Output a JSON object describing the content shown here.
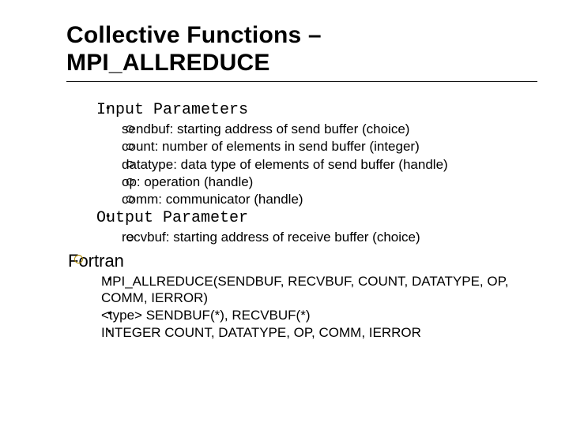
{
  "title_line1": "Collective Functions –",
  "title_line2": "MPI_ALLREDUCE",
  "sections": {
    "input": {
      "label": "Input Parameters",
      "items": [
        "sendbuf: starting address of send buffer (choice)",
        "count: number of elements in send buffer (integer)",
        "datatype: data type of elements of send buffer (handle)",
        "op: operation (handle)",
        "comm: communicator (handle)"
      ]
    },
    "output": {
      "label": "Output Parameter",
      "items": [
        "recvbuf: starting address of receive buffer (choice)"
      ]
    },
    "fortran": {
      "label": "Fortran",
      "items": [
        "MPI_ALLREDUCE(SENDBUF, RECVBUF, COUNT, DATATYPE, OP, COMM, IERROR)",
        "<type> SENDBUF(*), RECVBUF(*)",
        "INTEGER COUNT, DATATYPE, OP, COMM, IERROR"
      ]
    }
  }
}
